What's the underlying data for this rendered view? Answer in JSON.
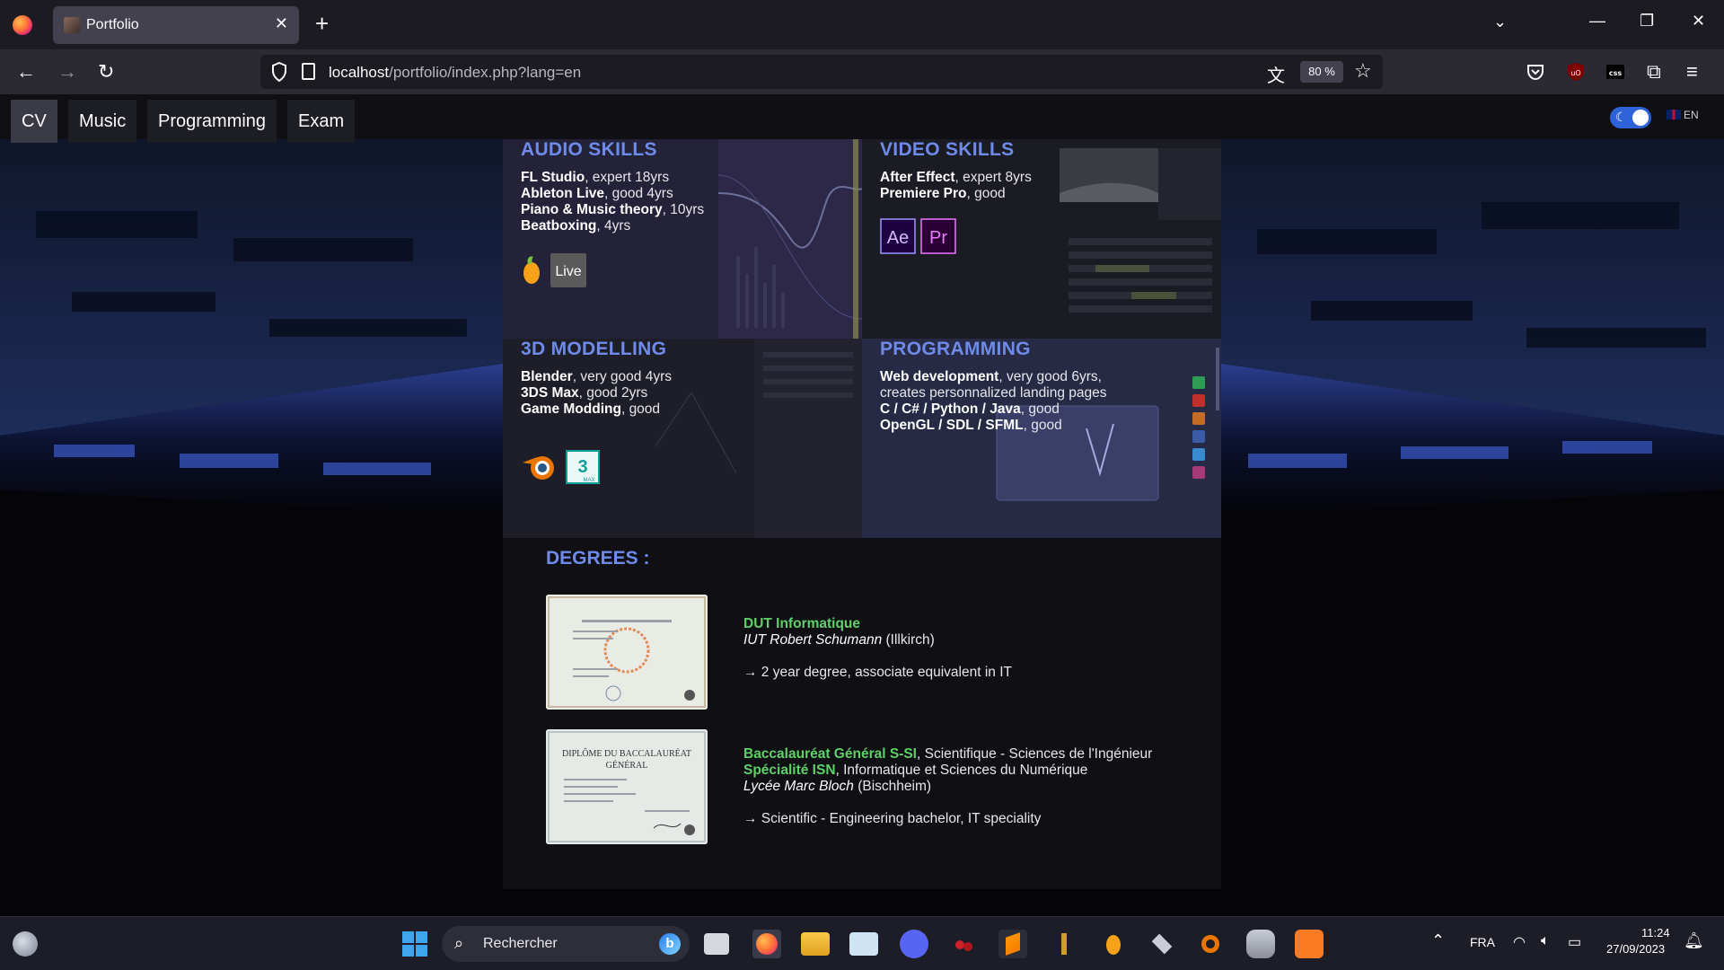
{
  "browser": {
    "tab_title": "Portfolio",
    "url_host": "localhost",
    "url_path": "/portfolio/index.php?lang=en",
    "zoom": "80 %"
  },
  "site_nav": {
    "items": [
      "CV",
      "Music",
      "Programming",
      "Exam"
    ],
    "active": "CV",
    "language": "EN"
  },
  "skills": [
    {
      "title": "AUDIO SKILLS",
      "lines": [
        {
          "bold": "FL Studio",
          "rest": ", expert 18yrs"
        },
        {
          "bold": "Ableton Live",
          "rest": ", good 4yrs"
        },
        {
          "bold": "Piano & Music theory",
          "rest": ", 10yrs"
        },
        {
          "bold": "Beatboxing",
          "rest": ", 4yrs"
        }
      ],
      "badges": [
        "fl-studio-logo",
        "Live"
      ]
    },
    {
      "title": "VIDEO SKILLS",
      "lines": [
        {
          "bold": "After Effect",
          "rest": ", expert 8yrs"
        },
        {
          "bold": "Premiere Pro",
          "rest": ", good"
        }
      ],
      "badges": [
        "Ae",
        "Pr"
      ]
    },
    {
      "title": "3D MODELLING",
      "lines": [
        {
          "bold": "Blender",
          "rest": ", very good 4yrs"
        },
        {
          "bold": "3DS Max",
          "rest": ", good 2yrs"
        },
        {
          "bold": "Game Modding",
          "rest": ", good"
        }
      ],
      "badges": [
        "blender-logo",
        "3",
        "MAX"
      ]
    },
    {
      "title": "PROGRAMMING",
      "lines": [
        {
          "bold": "Web development",
          "rest": ", very good 6yrs,"
        },
        {
          "bold": "",
          "rest": "creates personnalized landing pages"
        },
        {
          "bold": "C / C# / Python / Java",
          "rest": ", good"
        },
        {
          "bold": "OpenGL / SDL / SFML",
          "rest": ", good"
        }
      ]
    }
  ],
  "degrees": {
    "title": "DEGREES :",
    "items": [
      {
        "name": "DUT Informatique",
        "school": "IUT Robert Schumann",
        "place": " (Illkirch)",
        "desc": "→ 2 year degree, associate equivalent in IT"
      },
      {
        "name": "Baccalauréat Général S-SI",
        "name_rest": ", Scientifique - Sciences de l'Ingénieur",
        "speciality": "Spécialité ISN",
        "speciality_rest": ", Informatique et Sciences du Numérique",
        "school": "Lycée Marc Bloch",
        "place": " (Bischheim)",
        "desc": "→ Scientific - Engineering bachelor, IT speciality",
        "image_text": "DIPLÔME DU BACCALAURÉAT GÉNÉRAL"
      }
    ]
  },
  "taskbar": {
    "search_placeholder": "Rechercher",
    "language": "FRA",
    "time": "11:24",
    "date": "27/09/2023"
  },
  "colors": {
    "accent_blue": "#6e8bea",
    "degree_green": "#5ed169",
    "toggle_blue": "#2d62d8"
  }
}
